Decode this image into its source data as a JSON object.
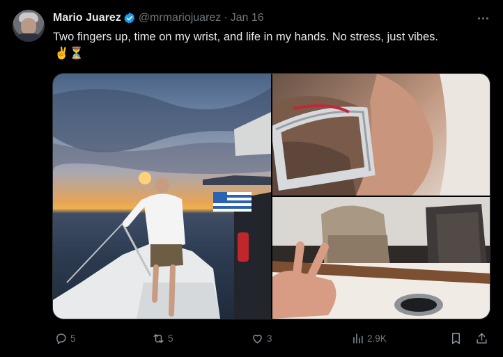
{
  "author": {
    "name": "Mario Juarez",
    "handle": "@mrmariojuarez",
    "separator": "·",
    "date": "Jan 16",
    "verified": true
  },
  "tweet": {
    "text": "Two fingers up, time on my wrist, and life in my hands. No stress, just vibes.",
    "emojis": "✌️⏳"
  },
  "media": {
    "images": [
      {
        "subject": "man on boat deck at sunset"
      },
      {
        "subject": "wrist with steel watch"
      },
      {
        "subject": "hand with two fingers up and designer bags"
      }
    ]
  },
  "actions": {
    "replies": "5",
    "reposts": "5",
    "likes": "3",
    "views": "2.9K"
  },
  "icons": {
    "verified": "verified-badge-icon",
    "more": "more-options-icon",
    "reply": "reply-icon",
    "repost": "repost-icon",
    "like": "heart-icon",
    "views": "views-icon",
    "bookmark": "bookmark-icon",
    "share": "share-icon"
  },
  "colors": {
    "background": "#000000",
    "text": "#e7e9ea",
    "muted": "#71767b",
    "verified": "#1d9bf0"
  }
}
